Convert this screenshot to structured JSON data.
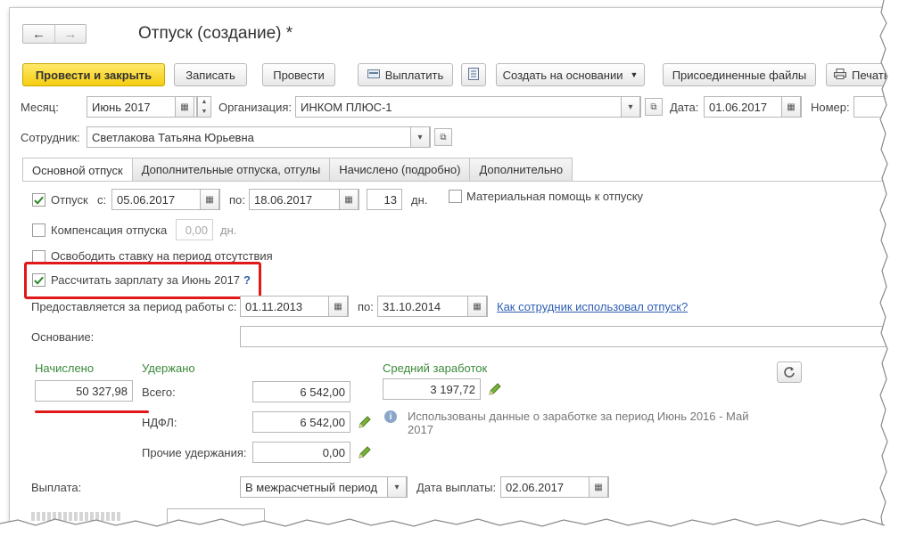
{
  "window": {
    "title": "Отпуск (создание) *"
  },
  "nav": {
    "back": "←",
    "forward": "→"
  },
  "toolbar": {
    "post_close": "Провести и закрыть",
    "save": "Записать",
    "post": "Провести",
    "pay": "Выплатить",
    "create_based": "Создать на основании",
    "attached_files": "Присоединенные файлы",
    "print": "Печать"
  },
  "header": {
    "month_label": "Месяц:",
    "month_value": "Июнь 2017",
    "org_label": "Организация:",
    "org_value": "ИНКОМ ПЛЮС-1",
    "date_label": "Дата:",
    "date_value": "01.06.2017",
    "number_label": "Номер:",
    "employee_label": "Сотрудник:",
    "employee_value": "Светлакова Татьяна Юрьевна"
  },
  "tabs": [
    {
      "label": "Основной отпуск",
      "active": true
    },
    {
      "label": "Дополнительные отпуска, отгулы",
      "active": false
    },
    {
      "label": "Начислено (подробно)",
      "active": false
    },
    {
      "label": "Дополнительно",
      "active": false
    }
  ],
  "leave": {
    "checked": true,
    "label": "Отпуск",
    "from_label": "с:",
    "from_value": "05.06.2017",
    "to_label": "по:",
    "to_value": "18.06.2017",
    "days_value": "13",
    "days_unit": "дн.",
    "material_help_label": "Материальная помощь к отпуску"
  },
  "compensation": {
    "checked": false,
    "label": "Компенсация отпуска",
    "value": "0,00",
    "unit": "дн."
  },
  "free_rate": {
    "checked": false,
    "label": "Освободить ставку на период отсутствия"
  },
  "calc_salary": {
    "checked": true,
    "label": "Рассчитать зарплату за Июнь 2017",
    "help": "?"
  },
  "work_period": {
    "label": "Предоставляется за период работы с:",
    "from_value": "01.11.2013",
    "to_label": "по:",
    "to_value": "31.10.2014",
    "link": "Как сотрудник использовал отпуск?"
  },
  "basis": {
    "label": "Основание:",
    "value": ""
  },
  "accrued": {
    "label": "Начислено",
    "value": "50 327,98"
  },
  "withheld": {
    "label": "Удержано",
    "total_label": "Всего:",
    "total_value": "6 542,00",
    "ndfl_label": "НДФЛ:",
    "ndfl_value": "6 542,00",
    "other_label": "Прочие удержания:",
    "other_value": "0,00"
  },
  "avg_earnings": {
    "label": "Средний заработок",
    "value": "3 197,72",
    "info": "Использованы данные о заработке за период Июнь 2016 - Май 2017"
  },
  "payment": {
    "label": "Выплата:",
    "value": "В межрасчетный период",
    "date_label": "Дата выплаты:",
    "date_value": "02.06.2017"
  },
  "colors": {
    "highlight": "#e01818",
    "accent_green": "#3a8a3a",
    "link": "#2f5fb3",
    "primary_button": "#f5cd10"
  }
}
